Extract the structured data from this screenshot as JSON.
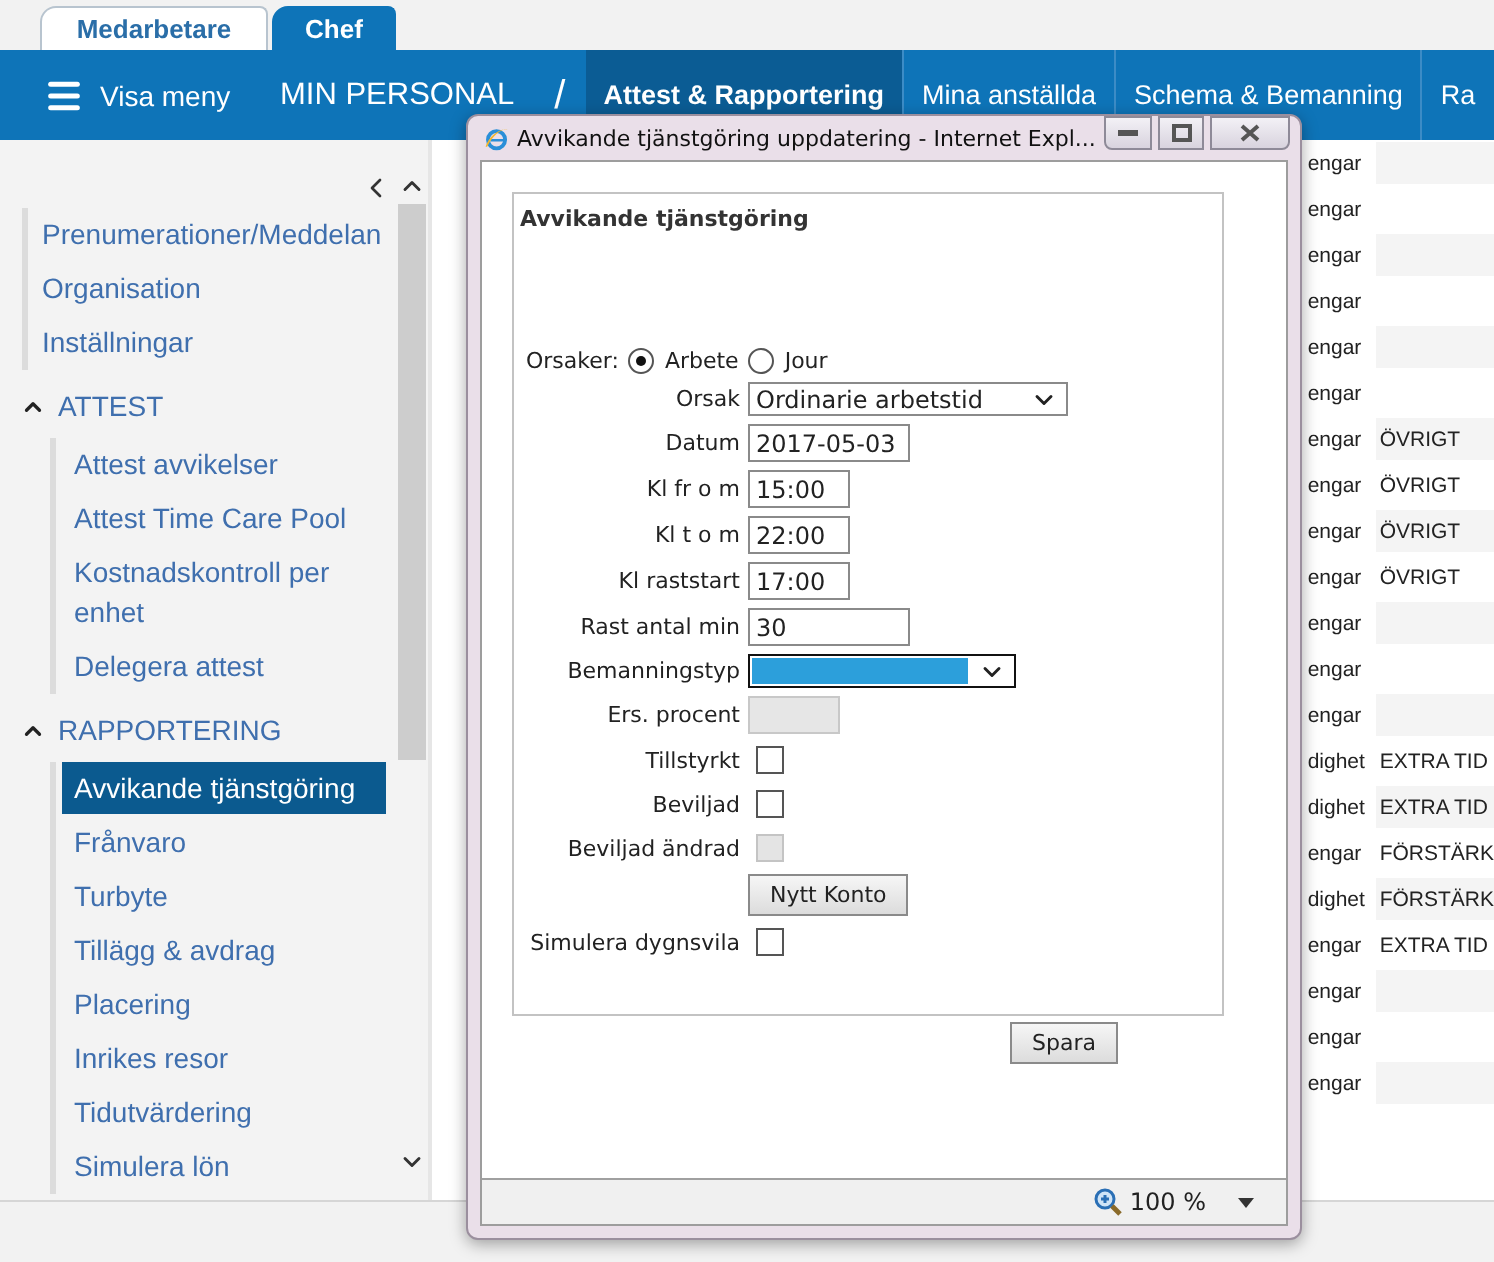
{
  "top_tabs": [
    {
      "label": "Medarbetare",
      "selected": false
    },
    {
      "label": "Chef",
      "selected": true
    }
  ],
  "nav": {
    "menu_button": "Visa meny",
    "section": "MIN PERSONAL",
    "separator": "/",
    "items": [
      {
        "label": "Attest & Rapportering",
        "selected": true
      },
      {
        "label": "Mina anställda",
        "selected": false
      },
      {
        "label": "Schema & Bemanning",
        "selected": false
      },
      {
        "label": "Ra",
        "selected": false
      }
    ]
  },
  "sidebar": {
    "items": [
      {
        "label": "Prenumerationer/Meddelan",
        "selected": false
      },
      {
        "label": "Organisation",
        "selected": false
      },
      {
        "label": "Inställningar",
        "selected": false
      }
    ],
    "groups": [
      {
        "label": "ATTEST",
        "expanded": true,
        "children": [
          {
            "label": "Attest avvikelser",
            "selected": false
          },
          {
            "label": "Attest Time Care Pool",
            "selected": false
          },
          {
            "label": "Kostnadskontroll per enhet",
            "selected": false
          },
          {
            "label": "Delegera attest",
            "selected": false
          }
        ]
      },
      {
        "label": "RAPPORTERING",
        "expanded": true,
        "children": [
          {
            "label": "Avvikande tjänstgöring",
            "selected": true
          },
          {
            "label": "Frånvaro",
            "selected": false
          },
          {
            "label": "Turbyte",
            "selected": false
          },
          {
            "label": "Tillägg & avdrag",
            "selected": false
          },
          {
            "label": "Placering",
            "selected": false
          },
          {
            "label": "Inrikes resor",
            "selected": false
          },
          {
            "label": "Tidutvärdering",
            "selected": false
          },
          {
            "label": "Simulera lön",
            "selected": false
          }
        ]
      }
    ]
  },
  "table": {
    "rows": [
      {
        "column_1": "engar"
      },
      {
        "column_1": "engar"
      },
      {
        "column_1": "engar"
      },
      {
        "column_1": "engar"
      },
      {
        "column_1": "engar"
      },
      {
        "column_1": "engar"
      },
      {
        "column_1": "engar",
        "column_2": "ÖVRIGT"
      },
      {
        "column_1": "engar",
        "column_2": "ÖVRIGT"
      },
      {
        "column_1": "engar",
        "column_2": "ÖVRIGT"
      },
      {
        "column_1": "engar",
        "column_2": "ÖVRIGT"
      },
      {
        "column_1": "engar"
      },
      {
        "column_1": "engar"
      },
      {
        "column_1": "engar"
      },
      {
        "column_1": "dighet",
        "column_2": "EXTRA TID"
      },
      {
        "column_1": "dighet",
        "column_2": "EXTRA TID"
      },
      {
        "column_1": "engar",
        "column_2": "FÖRSTÄRK"
      },
      {
        "column_1": "dighet",
        "column_2": "FÖRSTÄRK"
      },
      {
        "column_1": "engar",
        "column_2": "EXTRA TID"
      },
      {
        "column_1": "engar"
      },
      {
        "column_1": "engar"
      },
      {
        "column_1": "engar"
      }
    ]
  },
  "dialog": {
    "title": "Avvikande tjänstgöring uppdatering - Internet Expl...",
    "panel_title": "Avvikande tjänstgöring",
    "reasons": {
      "label": "Orsaker:",
      "options": [
        {
          "label": "Arbete",
          "selected": true
        },
        {
          "label": "Jour",
          "selected": false
        }
      ]
    },
    "fields": [
      {
        "kind": "select",
        "label": "Orsak",
        "value": "Ordinarie arbetstid",
        "highlighted": false
      },
      {
        "kind": "text",
        "label": "Datum",
        "value": "2017-05-03",
        "disabled": false
      },
      {
        "kind": "text",
        "label": "Kl fr o m",
        "value": "15:00",
        "disabled": false
      },
      {
        "kind": "text",
        "label": "Kl t o m",
        "value": "22:00",
        "disabled": false
      },
      {
        "kind": "text",
        "label": "Kl raststart",
        "value": "17:00",
        "disabled": false
      },
      {
        "kind": "text",
        "label": "Rast antal min",
        "value": "30",
        "disabled": false
      },
      {
        "kind": "select",
        "label": "Bemanningstyp",
        "highlighted": true
      },
      {
        "kind": "text",
        "label": "Ers. procent",
        "disabled": true
      },
      {
        "kind": "checkbox",
        "label": "Tillstyrkt",
        "checked": false,
        "disabled": false
      },
      {
        "kind": "checkbox",
        "label": "Beviljad",
        "checked": false,
        "disabled": false
      },
      {
        "kind": "checkbox",
        "label": "Beviljad ändrad",
        "checked": false,
        "disabled": true
      },
      {
        "kind": "button",
        "label": "Nytt Konto"
      },
      {
        "kind": "checkbox",
        "label": "Simulera dygnsvila",
        "checked": false,
        "disabled": false
      }
    ],
    "save_button": "Spara",
    "zoom": "100 %"
  }
}
